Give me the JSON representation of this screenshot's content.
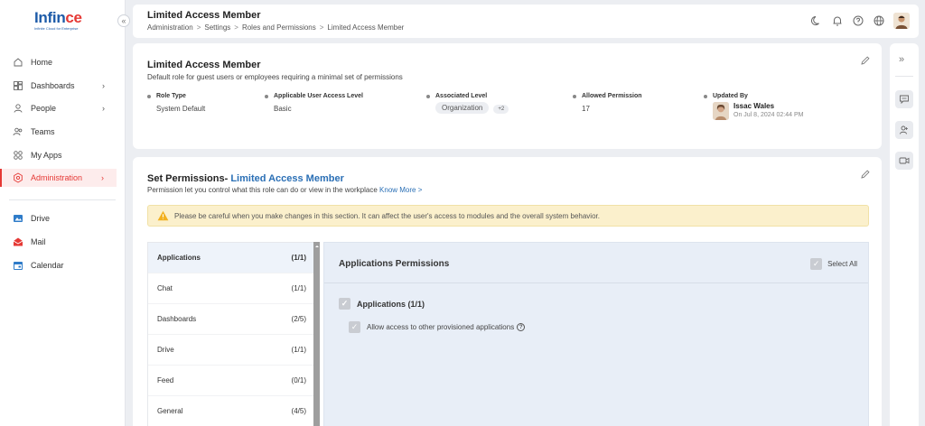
{
  "brand": {
    "name_main": "Inf",
    "name_i": "i",
    "name_n": "n",
    "name_ce": "ce",
    "tagline": "Infinite Cloud for Enterprise"
  },
  "sidebar": {
    "collapse_glyph": "«",
    "items": [
      {
        "label": "Home",
        "icon": "home-icon",
        "chevron": ""
      },
      {
        "label": "Dashboards",
        "icon": "dashboard-icon",
        "chevron": "›"
      },
      {
        "label": "People",
        "icon": "person-icon",
        "chevron": "›"
      },
      {
        "label": "Teams",
        "icon": "teams-icon",
        "chevron": ""
      },
      {
        "label": "My Apps",
        "icon": "apps-icon",
        "chevron": ""
      },
      {
        "label": "Administration",
        "icon": "settings-gear-icon",
        "chevron": "›",
        "active": true
      }
    ],
    "apps": [
      {
        "label": "Drive",
        "icon": "drive-icon"
      },
      {
        "label": "Mail",
        "icon": "mail-icon"
      },
      {
        "label": "Calendar",
        "icon": "calendar-icon"
      }
    ]
  },
  "header": {
    "title": "Limited Access Member",
    "breadcrumb": [
      "Administration",
      "Settings",
      "Roles and Permissions",
      "Limited Access Member"
    ],
    "breadcrumb_sep": ">",
    "icons": [
      "moon-icon",
      "bell-icon",
      "help-icon",
      "globe-icon",
      "user-avatar"
    ]
  },
  "role": {
    "title": "Limited Access Member",
    "description": "Default role for guest users or employees requiring a minimal set of permissions",
    "role_type_label": "Role Type",
    "role_type": "System Default",
    "access_level_label": "Applicable User Access Level",
    "access_level": "Basic",
    "associated_label": "Associated Level",
    "associated": "Organization",
    "associated_more": "+2",
    "allowed_label": "Allowed Permission",
    "allowed": "17",
    "updated_label": "Updated By",
    "updated_name": "Issac Wales",
    "updated_date": "On Jul 8, 2024 02:44 PM"
  },
  "permissions": {
    "title_prefix": "Set Permissions- ",
    "title_role": "Limited Access Member",
    "description": "Permission let you control what this role can do or view in the workplace",
    "know_more": "Know More >",
    "warning": "Please be careful when you make changes in this section. It can affect the user's access to modules and the overall system behavior.",
    "categories": [
      {
        "name": "Applications",
        "count": "(1/1)",
        "active": true
      },
      {
        "name": "Chat",
        "count": "(1/1)"
      },
      {
        "name": "Dashboards",
        "count": "(2/5)"
      },
      {
        "name": "Drive",
        "count": "(1/1)"
      },
      {
        "name": "Feed",
        "count": "(0/1)"
      },
      {
        "name": "General",
        "count": "(4/5)"
      }
    ],
    "panel_title": "Applications Permissions",
    "select_all": "Select All",
    "group_label": "Applications (1/1)",
    "item_label": "Allow access to other provisioned applications",
    "check_glyph": "✓",
    "help_glyph": "?"
  },
  "right_rail": {
    "expand_glyph": "»",
    "icons": [
      "chat-icon",
      "people-icon",
      "video-icon"
    ]
  },
  "colors": {
    "accent": "#e53935",
    "brand": "#1d5ba8",
    "link": "#2a6fb5",
    "warning_bg": "#fbf0cc"
  }
}
